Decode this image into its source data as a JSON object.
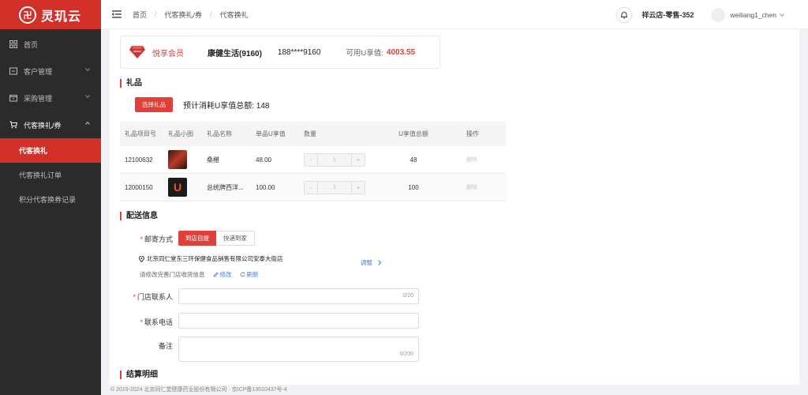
{
  "app": {
    "logo_mark": "卍",
    "logo_text": "灵玑云"
  },
  "sidebar": {
    "items": [
      {
        "label": "首页",
        "icon": "grid-icon"
      },
      {
        "label": "客户管理",
        "icon": "customer-icon"
      },
      {
        "label": "采购管理",
        "icon": "purchase-icon"
      },
      {
        "label": "代客换礼/券",
        "icon": "cart-icon"
      }
    ],
    "subitems": [
      {
        "label": "代客换礼",
        "active": true
      },
      {
        "label": "代客换礼订单"
      },
      {
        "label": "积分代客换券记录"
      }
    ]
  },
  "header": {
    "breadcrumb": [
      "首页",
      "代客换礼/券",
      "代客换礼"
    ],
    "store": "祥云店-零售-352",
    "user": "weiliang1_chen"
  },
  "member": {
    "level": "悦享会员",
    "company": "康健生活(9160)",
    "phone": "188****9160",
    "points_label": "可用U享值:",
    "points_value": "4003.55"
  },
  "gifts": {
    "title": "礼品",
    "select_button": "选择礼品",
    "estimate": "预计消耗U享值总额: 148",
    "columns": [
      "礼品项目号",
      "礼品小图",
      "礼品名称",
      "单品U享值",
      "数量",
      "U享值总额",
      "操作"
    ],
    "rows": [
      {
        "id": "12100632",
        "name": "桑椹",
        "unit": "48.00",
        "qty": "1",
        "total": "48",
        "action": "删除"
      },
      {
        "id": "12000150",
        "name": "总统牌西洋...",
        "unit": "100.00",
        "qty": "1",
        "total": "100",
        "action": "删除"
      }
    ],
    "stepper_minus": "-",
    "stepper_plus": "+"
  },
  "delivery": {
    "title": "配送信息",
    "method_label": "邮寄方式",
    "method_options": [
      "到店自提",
      "快递到家"
    ],
    "address": "北京同仁堂东三环保健食品销售有限公司安泰大街店",
    "adjust": "调整",
    "hint": "请修改完善门店收货信息",
    "edit": "修改",
    "refresh": "刷新",
    "contact_label": "门店联系人",
    "contact_counter": "0/20",
    "phone_label": "联系电话",
    "remark_label": "备注",
    "remark_counter": "0/200"
  },
  "settlement": {
    "title": "结算明细"
  },
  "footer": {
    "text": "© 2019-2024 北京同仁堂健康药业股份有限公司 · 京ICP备13010437号-4"
  },
  "colors": {
    "brand": "#d4302a",
    "accent": "#e0403a",
    "link": "#3b82d6",
    "sidebar_bg": "#2b2b2b"
  }
}
